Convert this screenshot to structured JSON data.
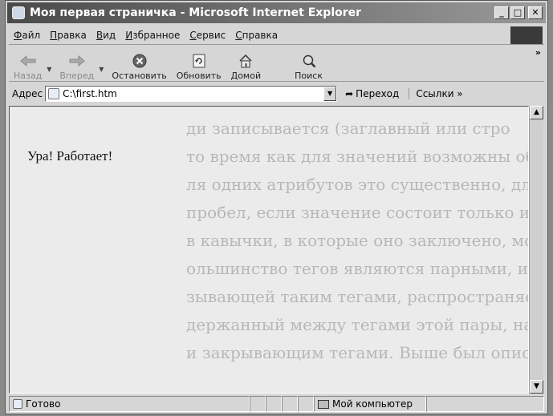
{
  "window": {
    "title": "Моя первая страничка - Microsoft Internet Explorer"
  },
  "menu": {
    "items": [
      {
        "u": "Ф",
        "rest": "айл"
      },
      {
        "u": "П",
        "rest": "равка"
      },
      {
        "u": "В",
        "rest": "ид"
      },
      {
        "u": "И",
        "rest": "збранное"
      },
      {
        "u": "С",
        "rest": "ервис"
      },
      {
        "u": "С",
        "rest": "правка"
      }
    ]
  },
  "toolbar": {
    "back": "Назад",
    "forward": "Вперед",
    "stop": "Остановить",
    "refresh": "Обновить",
    "home": "Домой",
    "search": "Поиск",
    "more": "»"
  },
  "address": {
    "label": "Адрес",
    "value": "C:\\first.htm",
    "go": "Переход",
    "links": "Ссылки »"
  },
  "page": {
    "text": "Ура! Работает!",
    "ghost_lines": [
      "ди записывается (заглавный или стро",
      "то время как для значений возможны оба вариа",
      "ля одних атрибутов это существенно, для других",
      "пробел, если значение состоит только из латинских",
      "в кавычки, в которые оно заключено, можно не",
      "",
      "ольшинство тегов являются парными, и действие ко",
      "зывающей таким тегами, распространяется на участок",
      "держанный между тегами этой пары, называемыми откр",
      "и закрывающим тегами. Выше был описан открываю"
    ]
  },
  "status": {
    "text": "Готово",
    "zone": "Мой компьютер"
  },
  "colors": {
    "titlebar_start": "#4a4a4a",
    "titlebar_end": "#9a9a9a",
    "chrome": "#d6d6d6",
    "content_bg": "#ebebeb"
  }
}
